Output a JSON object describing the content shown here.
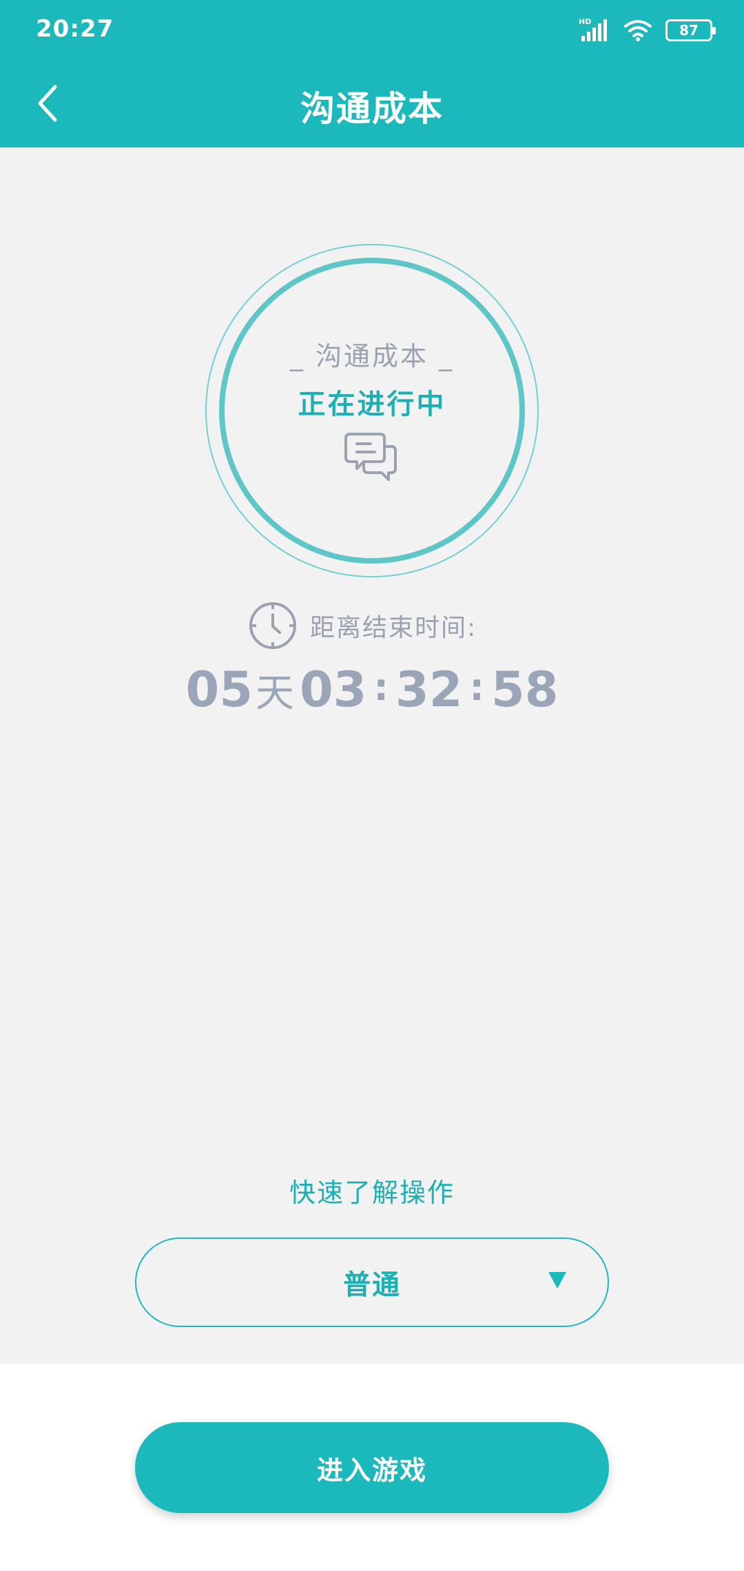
{
  "status_bar": {
    "time": "20:27",
    "network_label": "HD",
    "battery_level": "87",
    "icons": [
      "signal-icon",
      "wifi-icon",
      "battery-icon"
    ]
  },
  "nav": {
    "title": "沟通成本",
    "back_icon": "chevron-left-icon"
  },
  "status_ring": {
    "label": "_ 沟通成本 _",
    "status": "正在进行中",
    "icon": "chat-bubbles-icon"
  },
  "countdown": {
    "label": "距离结束时间:",
    "icon": "clock-icon",
    "days": "05",
    "days_unit": "天",
    "hours": "03",
    "minutes": "32",
    "seconds": "58",
    "separator": ":"
  },
  "quick_guide": {
    "label": "快速了解操作"
  },
  "mode_select": {
    "selected": "普通",
    "arrow_icon": "triangle-down-icon"
  },
  "enter_button": {
    "label": "进入游戏"
  },
  "colors": {
    "primary": "#1cb9bc",
    "background": "#f2f2f2",
    "muted_text": "#9aa2b0",
    "countdown_text": "#9aa5b8"
  }
}
